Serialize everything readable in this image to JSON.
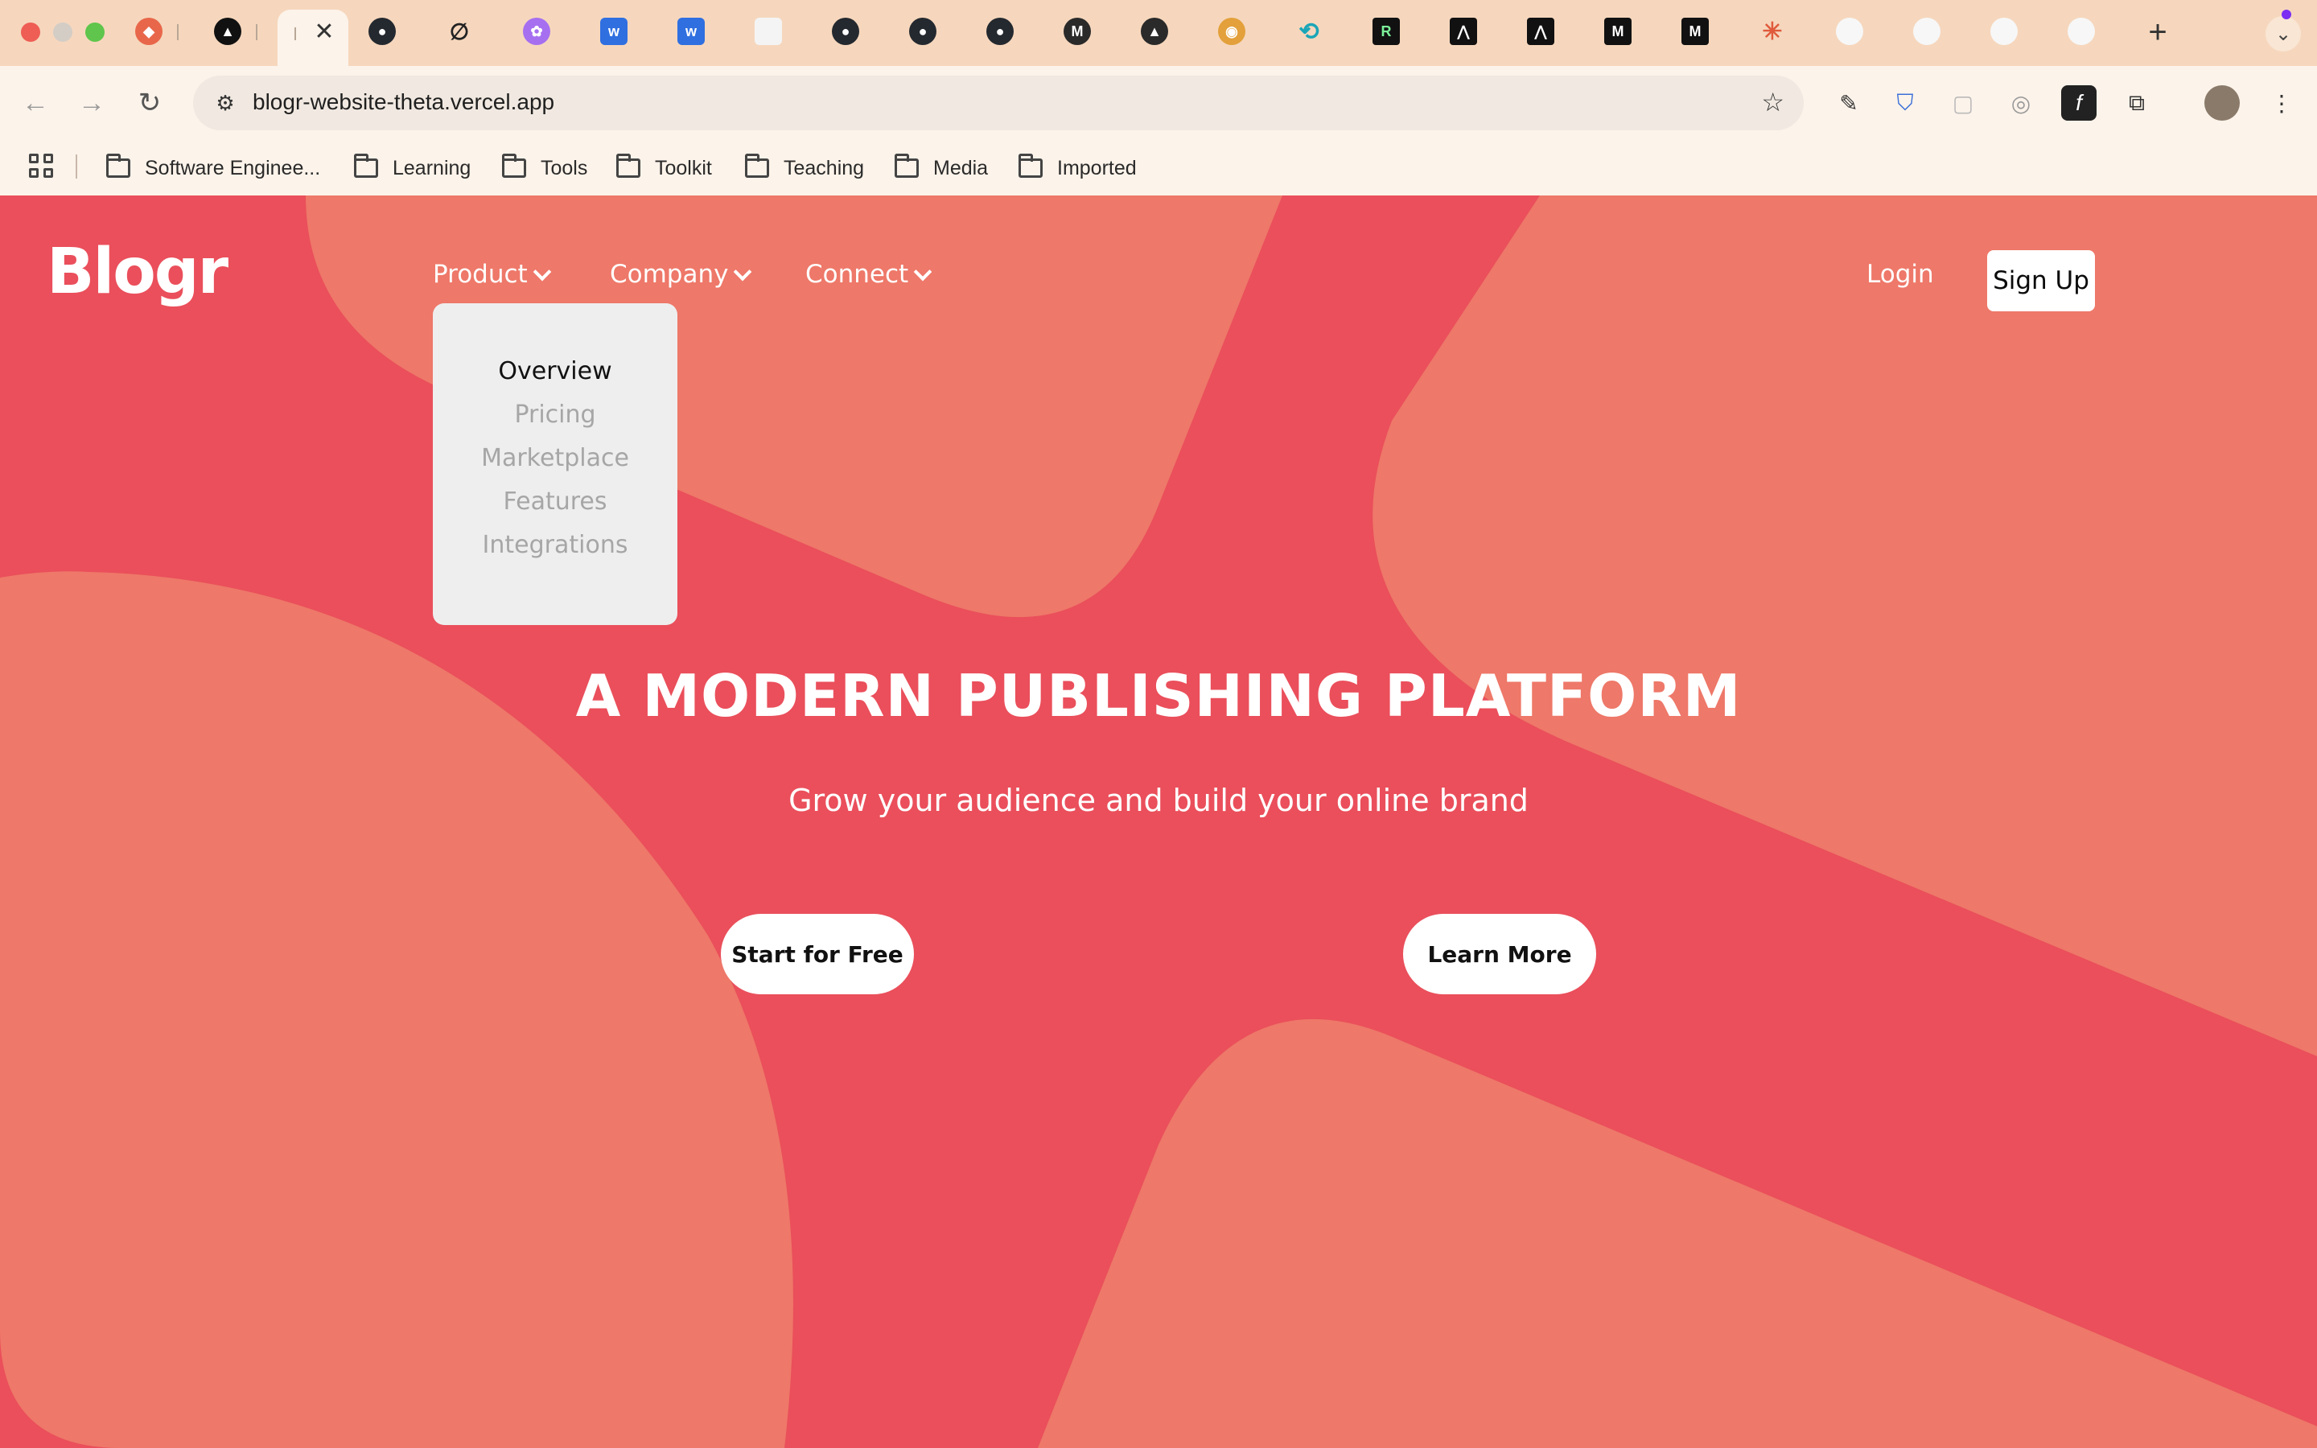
{
  "browser": {
    "url": "blogr-website-theta.vercel.app",
    "bookmarks": [
      "Software Enginee...",
      "Learning",
      "Tools",
      "Toolkit",
      "Teaching",
      "Media",
      "Imported"
    ]
  },
  "site": {
    "logo": "Blogr",
    "nav": [
      "Product",
      "Company",
      "Connect"
    ],
    "login": "Login",
    "signup": "Sign Up",
    "dropdown": [
      "Overview",
      "Pricing",
      "Marketplace",
      "Features",
      "Integrations"
    ],
    "hero_title": "A MODERN PUBLISHING PLATFORM",
    "hero_subtitle": "Grow your audience and build your online brand",
    "cta_primary": "Start for Free",
    "cta_secondary": "Learn More"
  },
  "colors": {
    "background": "#ea4f5b",
    "shape": "#ee7869",
    "dropdown_bg": "#eeeeee",
    "tab_strip": "#f6d7bd"
  }
}
